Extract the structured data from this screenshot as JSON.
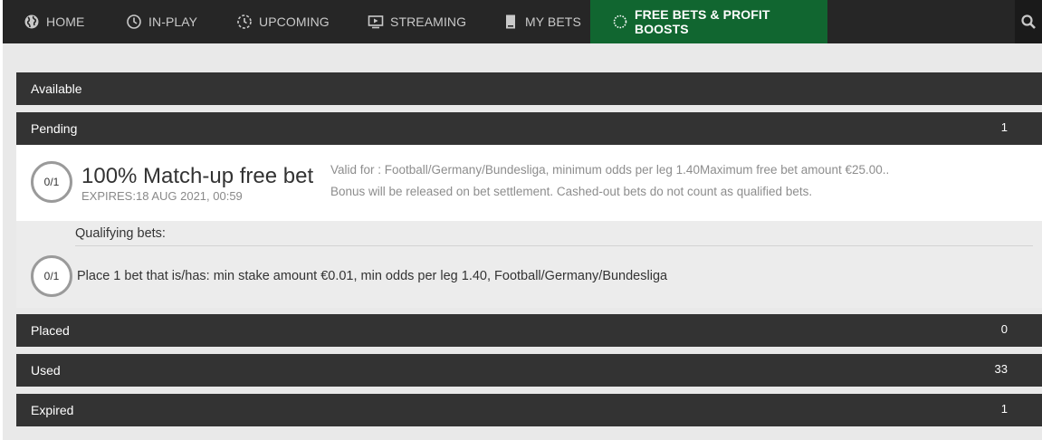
{
  "nav": {
    "items": [
      {
        "label": "HOME",
        "icon": "globe-icon"
      },
      {
        "label": "IN-PLAY",
        "icon": "clock-icon"
      },
      {
        "label": "UPCOMING",
        "icon": "timer-icon"
      },
      {
        "label": "STREAMING",
        "icon": "tv-play-icon"
      },
      {
        "label": "MY BETS",
        "icon": "bet-slip-icon"
      },
      {
        "label": "FREE BETS & PROFIT BOOSTS",
        "icon": "spinner-icon",
        "active": true
      }
    ],
    "search_icon": "search-icon"
  },
  "sections": {
    "available": {
      "label": "Available",
      "count": ""
    },
    "pending": {
      "label": "Pending",
      "count": "1"
    },
    "placed": {
      "label": "Placed",
      "count": "0"
    },
    "used": {
      "label": "Used",
      "count": "33"
    },
    "expired": {
      "label": "Expired",
      "count": "1"
    }
  },
  "bonus": {
    "progress": "0/1",
    "title": "100% Match-up free bet",
    "expires": "EXPIRES:18 AUG 2021, 00:59",
    "valid_for": "Valid for : Football/Germany/Bundesliga, minimum odds per leg 1.40Maximum free bet amount €25.00..",
    "release_note": "Bonus will be released on bet settlement. Cashed-out bets do not count as qualified bets."
  },
  "qualifying": {
    "title": "Qualifying bets:",
    "progress": "0/1",
    "requirement": "Place 1 bet that is/has: min stake amount €0.01, min odds per leg 1.40, Football/Germany/Bundesliga"
  },
  "colors": {
    "nav_bg": "#262626",
    "active_tab": "#116630",
    "section_bar": "#333333",
    "page_bg": "#e9e9e9"
  }
}
